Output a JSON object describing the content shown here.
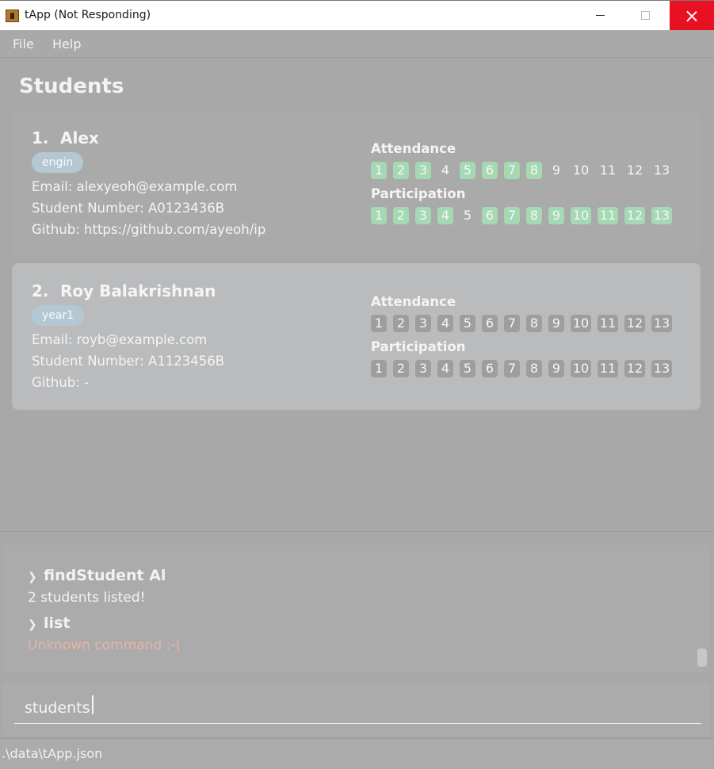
{
  "window": {
    "title": "tApp (Not Responding)",
    "icon": "app-icon"
  },
  "menu": {
    "file": "File",
    "help": "Help"
  },
  "students": {
    "title": "Students",
    "attendance_label": "Attendance",
    "participation_label": "Participation",
    "items": [
      {
        "index": "1.",
        "name": "Alex",
        "tag": "engin",
        "email": "Email: alexyeoh@example.com",
        "student_number": "Student Number: A0123436B",
        "github": "Github: https://github.com/ayeoh/ip",
        "attendance": [
          true,
          true,
          true,
          false,
          true,
          true,
          true,
          true,
          false,
          false,
          false,
          false,
          false
        ],
        "participation": [
          true,
          true,
          true,
          true,
          false,
          true,
          true,
          true,
          true,
          true,
          true,
          true,
          true
        ]
      },
      {
        "index": "2.",
        "name": "Roy Balakrishnan",
        "tag": "year1",
        "email": "Email: royb@example.com",
        "student_number": "Student Number: A1123456B",
        "github": "Github: -",
        "attendance": [
          "grey",
          "grey",
          "grey",
          "grey",
          "grey",
          "grey",
          "grey",
          "grey",
          "grey",
          "grey",
          "grey",
          "grey",
          "grey"
        ],
        "participation": [
          "grey",
          "grey",
          "grey",
          "grey",
          "grey",
          "grey",
          "grey",
          "grey",
          "grey",
          "grey",
          "grey",
          "grey",
          "grey"
        ]
      }
    ],
    "weeks": [
      "1",
      "2",
      "3",
      "4",
      "5",
      "6",
      "7",
      "8",
      "9",
      "10",
      "11",
      "12",
      "13"
    ]
  },
  "result": {
    "cmd1": "findStudent Al",
    "msg1": "2 students listed!",
    "cmd2": "list",
    "msg2": "Unknown command :-(",
    "prompt_icon": "chevron-right-icon"
  },
  "command": {
    "value": "students"
  },
  "status": {
    "path": ".\\data\\tApp.json"
  },
  "colors": {
    "present": "#a4d9b3",
    "unmarked": "#9e9e9e",
    "close": "#e81123",
    "error": "#e6b4a6"
  }
}
